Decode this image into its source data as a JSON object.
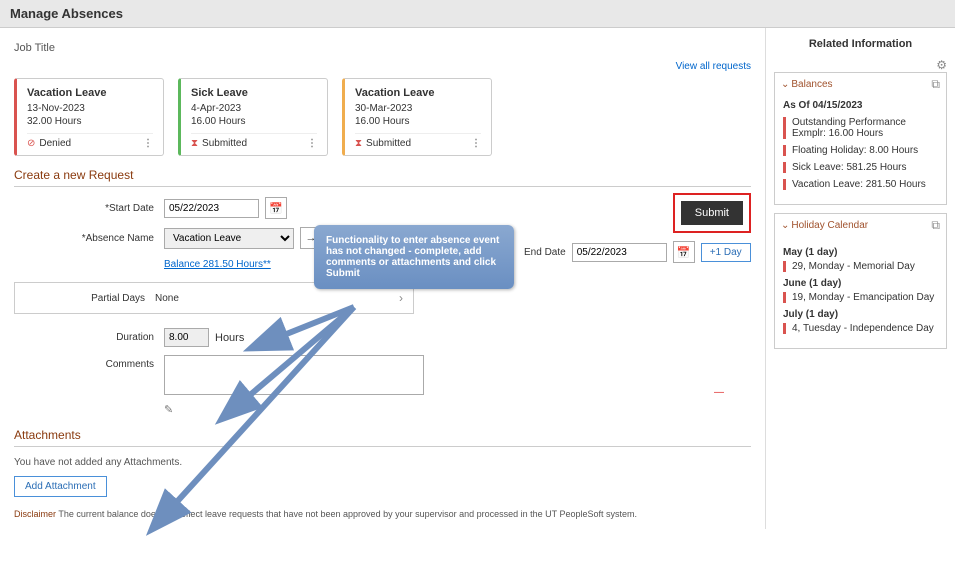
{
  "header": {
    "title": "Manage Absences",
    "job_title": "Job Title",
    "view_all": "View all requests"
  },
  "cards": [
    {
      "title": "Vacation Leave",
      "date": "13-Nov-2023",
      "hours": "32.00 Hours",
      "status_label": "Denied",
      "status_kind": "denied"
    },
    {
      "title": "Sick Leave",
      "date": "4-Apr-2023",
      "hours": "16.00 Hours",
      "status_label": "Submitted",
      "status_kind": "pending"
    },
    {
      "title": "Vacation Leave",
      "date": "30-Mar-2023",
      "hours": "16.00 Hours",
      "status_label": "Submitted",
      "status_kind": "pending"
    }
  ],
  "create": {
    "heading": "Create a new Request"
  },
  "form": {
    "start_date_label": "*Start Date",
    "start_date": "05/22/2023",
    "end_date_label": "End Date",
    "end_date": "05/22/2023",
    "plus_day": "+1 Day",
    "absence_name_label": "*Absence Name",
    "absence_name": "Vacation Leave",
    "balance_link": "Balance 281.50 Hours**",
    "partial_label": "Partial Days",
    "partial_value": "None",
    "duration_label": "Duration",
    "duration_value": "8.00",
    "duration_unit": "Hours",
    "comments_label": "Comments",
    "submit": "Submit"
  },
  "callout": {
    "text": "Functionality to enter absence event has not changed - complete, add comments or attachments and click Submit"
  },
  "attachments": {
    "heading": "Attachments",
    "empty": "You have not added any Attachments.",
    "add": "Add Attachment"
  },
  "disclaimer": {
    "label": "Disclaimer",
    "text": "The current balance does not reflect leave requests that have not been approved by your supervisor and processed in the UT PeopleSoft system."
  },
  "side": {
    "title": "Related Information",
    "balances_heading": "Balances",
    "as_of": "As Of 04/15/2023",
    "balances": [
      {
        "label": "Outstanding Performance Exmplr: 16.00 Hours"
      },
      {
        "label": "Floating Holiday: 8.00 Hours"
      },
      {
        "label": "Sick Leave: 581.25 Hours"
      },
      {
        "label": "Vacation Leave: 281.50 Hours"
      }
    ],
    "hol_heading": "Holiday Calendar",
    "holidays": [
      {
        "month": "May (1 day)",
        "item": "29, Monday - Memorial Day"
      },
      {
        "month": "June (1 day)",
        "item": "19, Monday - Emancipation Day"
      },
      {
        "month": "July (1 day)",
        "item": "4, Tuesday - Independence Day"
      }
    ]
  }
}
